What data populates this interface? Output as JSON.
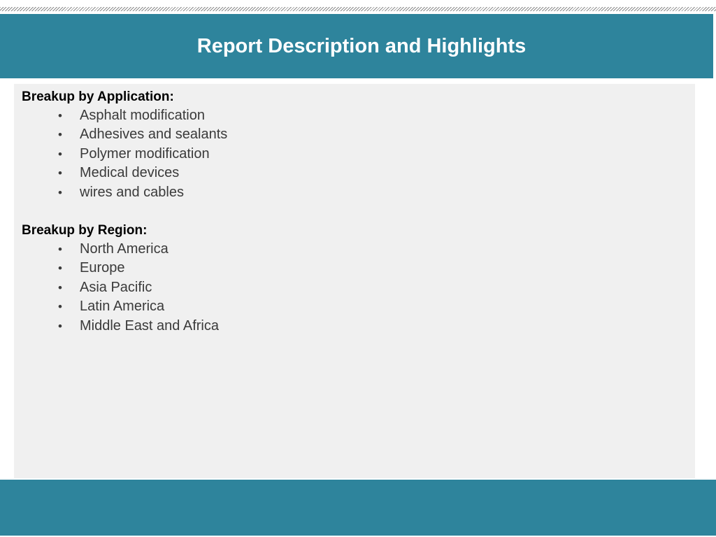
{
  "header": {
    "title": "Report Description and Highlights"
  },
  "application": {
    "heading": "Breakup by Application:",
    "items": [
      "Asphalt modification",
      "Adhesives and sealants",
      "Polymer modification",
      "Medical devices",
      "wires and cables"
    ]
  },
  "region": {
    "heading": "Breakup by Region:",
    "items": [
      "North America",
      "Europe",
      "Asia Pacific",
      "Latin America",
      "Middle East and Africa"
    ]
  },
  "bullet_glyph": "•",
  "colors": {
    "accent": "#2e849c",
    "panel": "#f0f0f0",
    "heading_text": "#000000",
    "body_text": "#3a3a3a"
  }
}
